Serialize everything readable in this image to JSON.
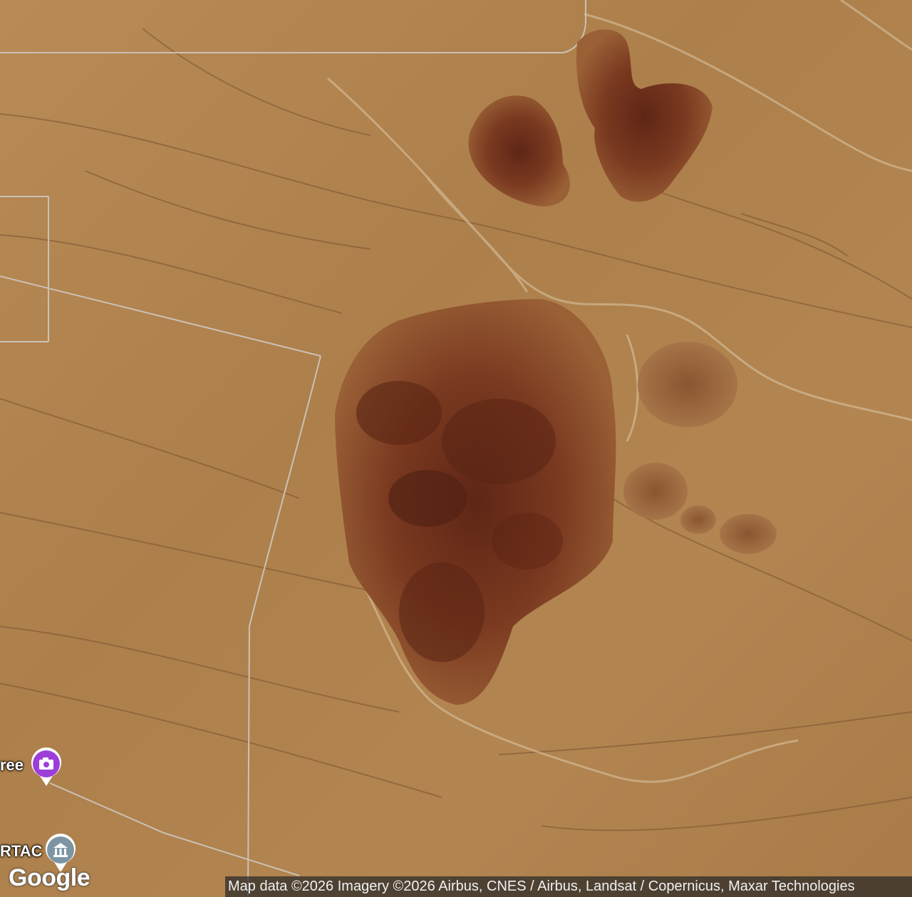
{
  "map": {
    "view_type": "satellite",
    "colors": {
      "terrain_base": "#b0824e",
      "hill_dark": "#6e2f1c",
      "hill_mid": "#8a4a2a",
      "road": "#c9c2b4",
      "wash": "#d8c3a0",
      "photo_pin": "#9c3fd9",
      "landmark_pin": "#7d95a3"
    }
  },
  "markers": [
    {
      "label": "ree",
      "icon": "camera-icon",
      "color": "#9c3fd9"
    },
    {
      "label": "RTAC",
      "icon": "landmark-icon",
      "color": "#7d95a3"
    }
  ],
  "branding": {
    "logo_text": "Google"
  },
  "attribution": {
    "text": "Map data ©2026 Imagery ©2026 Airbus, CNES / Airbus, Landsat / Copernicus, Maxar Technologies"
  }
}
